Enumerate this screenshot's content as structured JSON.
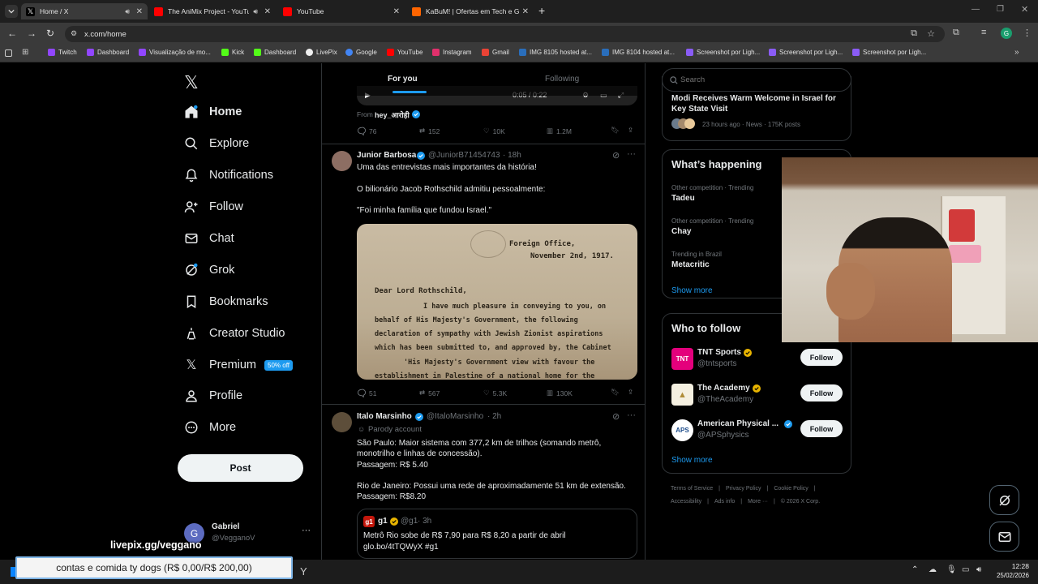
{
  "browser": {
    "tabs": [
      {
        "title": "Home / X",
        "active": true
      },
      {
        "title": "The AniMix Project - YouTu",
        "active": false
      },
      {
        "title": "YouTube",
        "active": false
      },
      {
        "title": "KaBuM! | Ofertas em Tech e Ga",
        "active": false
      }
    ],
    "url": "x.com/home",
    "profile_initial": "G",
    "bookmarks": [
      "Twitch",
      "Dashboard",
      "Visualização de mo...",
      "Kick",
      "Dashboard",
      "LivePix",
      "Google",
      "YouTube",
      "Instagram",
      "Gmail",
      "IMG 8105 hosted at...",
      "IMG 8104 hosted at...",
      "Screenshot por Ligh...",
      "Screenshot por Ligh...",
      "Screenshot por Ligh..."
    ]
  },
  "sidebar": {
    "items": [
      {
        "label": "Home",
        "icon": "home-icon"
      },
      {
        "label": "Explore",
        "icon": "search-icon"
      },
      {
        "label": "Notifications",
        "icon": "bell-icon"
      },
      {
        "label": "Follow",
        "icon": "add-person-icon"
      },
      {
        "label": "Chat",
        "icon": "mail-icon"
      },
      {
        "label": "Grok",
        "icon": "grok-icon"
      },
      {
        "label": "Bookmarks",
        "icon": "bookmark-icon"
      },
      {
        "label": "Creator Studio",
        "icon": "creator-icon"
      },
      {
        "label": "Premium",
        "icon": "x-icon"
      },
      {
        "label": "Profile",
        "icon": "person-icon"
      },
      {
        "label": "More",
        "icon": "more-circle-icon"
      }
    ],
    "premium_badge": "50% off",
    "post_button": "Post",
    "account": {
      "name": "Gabriel",
      "handle": "@VegganoV",
      "initial": "G"
    }
  },
  "feed": {
    "tabs": [
      "For you",
      "Following"
    ],
    "prev_post": {
      "from_label": "From",
      "from_name": "hey_आरोही",
      "video_time": "0:05 / 0:22",
      "stats": {
        "replies": "76",
        "reposts": "152",
        "likes": "10K",
        "views": "1.2M"
      }
    },
    "post1": {
      "name": "Junior Barbosa",
      "handle": "@JuniorB71454743",
      "time": "· 18h",
      "lines": [
        "Uma das entrevistas mais importantes da história!",
        "O bilionário Jacob Rothschild admitiu pessoalmente:",
        "\"Foi minha família que fundou Israel.\""
      ],
      "letter": {
        "header1": "Foreign Office,",
        "header2": "November 2nd, 1917.",
        "salutation": "Dear Lord Rothschild,",
        "body": [
          "I have much pleasure in conveying to you, on",
          "behalf of His Majesty's Government, the following",
          "declaration of sympathy with Jewish Zionist aspirations",
          "which has been submitted to, and approved by, the Cabinet",
          "'His Majesty's Government view with favour the",
          "establishment in Palestine of a national home for the"
        ]
      },
      "stats": {
        "replies": "51",
        "reposts": "567",
        "likes": "5.3K",
        "views": "130K"
      }
    },
    "post2": {
      "name": "Italo Marsinho",
      "handle": "@ItaloMarsinho",
      "time": "· 2h",
      "parody": "Parody account",
      "lines": [
        "São Paulo: Maior sistema com 377,2 km de trilhos (somando metrô,",
        "monotrilho e linhas de concessão).",
        "Passagem: R$ 5.40",
        "Rio de Janeiro: Possui uma rede de aproximadamente 51 km de extensão.",
        "Passagem: R$8.20"
      ],
      "quote": {
        "name": "g1",
        "handle": "@g1",
        "time": "· 3h",
        "text1": "Metrô Rio sobe de R$ 7,90 para R$ 8,20 a partir de abril",
        "text2": "glo.bo/4tTQWyX #g1"
      }
    }
  },
  "right": {
    "search_placeholder": "Search",
    "news": {
      "title1": "Modi Receives Warm Welcome in Israel for",
      "title2": "Key State Visit",
      "meta": "23 hours ago · News · 175K posts"
    },
    "happening": {
      "title": "What’s happening",
      "trends": [
        {
          "label": "Other competition · Trending",
          "name": "Tadeu"
        },
        {
          "label": "Other competition · Trending",
          "name": "Chay"
        },
        {
          "label": "Trending in Brazil",
          "name": "Metacritic"
        }
      ],
      "show_more": "Show more"
    },
    "who_to_follow": {
      "title": "Who to follow",
      "accounts": [
        {
          "name": "TNT Sports",
          "handle": "@tntsports",
          "avatar_text": "TNT",
          "color": "#e4007c"
        },
        {
          "name": "The Academy",
          "handle": "@TheAcademy",
          "avatar_text": "▲",
          "color": "#f5f0e1"
        },
        {
          "name": "American Physical ...",
          "handle": "@APSphysics",
          "avatar_text": "APS",
          "color": "#ffffff"
        }
      ],
      "follow_label": "Follow",
      "show_more": "Show more"
    },
    "footer": {
      "links1": [
        "Terms of Service",
        "Privacy Policy",
        "Cookie Policy"
      ],
      "links2": [
        "Accessibility",
        "Ads info",
        "More ···",
        "© 2026 X Corp."
      ]
    }
  },
  "overlay": {
    "stream_url": "livepix.gg/veggano",
    "goal_text": "contas e comida ty dogs (R$ 0,00/R$ 200,00)"
  },
  "taskbar": {
    "time": "12:28",
    "date": "25/02/2026"
  },
  "colors": {
    "accent": "#1d9bf0",
    "background": "#000000",
    "border": "#2f3336",
    "muted": "#71767b"
  }
}
